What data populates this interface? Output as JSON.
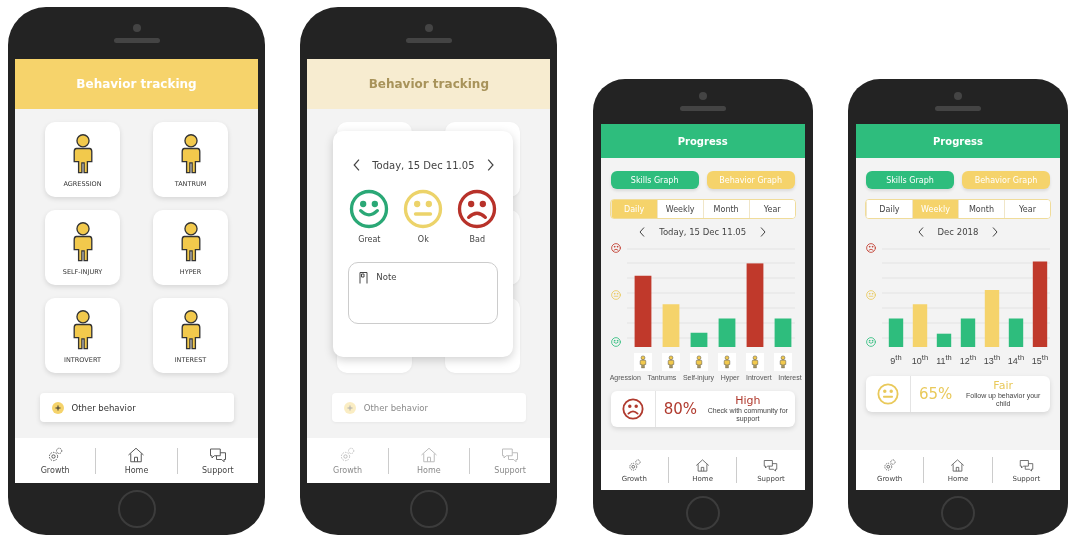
{
  "phones": [
    {
      "kind": "tracking",
      "title": "Behavior tracking",
      "behaviors": [
        {
          "label": "AGRESSION"
        },
        {
          "label": "TANTRUM"
        },
        {
          "label": "SELF-INJURY"
        },
        {
          "label": "HYPER"
        },
        {
          "label": "INTROVERT"
        },
        {
          "label": "INTEREST"
        }
      ],
      "other_behavior": "Other behavior",
      "nav": [
        {
          "kind": "growth",
          "label": "Growth"
        },
        {
          "kind": "home",
          "label": "Home"
        },
        {
          "kind": "support",
          "label": "Support"
        }
      ]
    },
    {
      "kind": "mood_dialog",
      "title": "Behavior tracking",
      "other_behavior": "Other behavior",
      "date": "Today, 15 Dec 11.05",
      "moods": [
        {
          "kind": "happy",
          "label": "Great",
          "color": "#2aa876"
        },
        {
          "kind": "neutral",
          "label": "Ok",
          "color": "#ecd36a"
        },
        {
          "kind": "sad",
          "label": "Bad",
          "color": "#b8322a"
        }
      ],
      "note": "Note",
      "nav": [
        {
          "kind": "growth",
          "label": "Growth"
        },
        {
          "kind": "home",
          "label": "Home"
        },
        {
          "kind": "support",
          "label": "Support"
        }
      ]
    },
    {
      "kind": "progress",
      "title": "Progress",
      "graph_buttons": [
        {
          "label": "Skills Graph",
          "color": "#2ebd7d"
        },
        {
          "label": "Behavior Graph",
          "color": "#f5d36b"
        }
      ],
      "periods": [
        {
          "label": "Daily",
          "selected": true
        },
        {
          "label": "Weekly",
          "selected": false
        },
        {
          "label": "Month",
          "selected": false
        },
        {
          "label": "Year",
          "selected": false
        }
      ],
      "date": "Today, 15 Dec 11.05",
      "label_tiles": true,
      "bars": [
        {
          "label": "Agression",
          "color": "#c0392b"
        },
        {
          "label": "Tantrums",
          "color": "#f5d36b"
        },
        {
          "label": "Self-injury",
          "color": "#2ebd7d"
        },
        {
          "label": "Hyper",
          "color": "#2ebd7d"
        },
        {
          "label": "Introvert",
          "color": "#c0392b"
        },
        {
          "label": "Interest",
          "color": "#2ebd7d"
        }
      ],
      "summary": {
        "kind": "sad",
        "percent": "80%",
        "rating": "High",
        "advice": "Check with community for support",
        "color": "#b03a2e"
      },
      "nav": [
        {
          "kind": "growth",
          "label": "Growth"
        },
        {
          "kind": "home",
          "label": "Home"
        },
        {
          "kind": "support",
          "label": "Support"
        }
      ]
    },
    {
      "kind": "progress",
      "title": "Progress",
      "graph_buttons": [
        {
          "label": "Skills Graph",
          "color": "#2ebd7d"
        },
        {
          "label": "Behavior Graph",
          "color": "#f5d36b"
        }
      ],
      "periods": [
        {
          "label": "Daily",
          "selected": false
        },
        {
          "label": "Weekly",
          "selected": true
        },
        {
          "label": "Month",
          "selected": false
        },
        {
          "label": "Year",
          "selected": false
        }
      ],
      "date": "Dec 2018",
      "bars": [
        {
          "label": "9$^{th}$",
          "color": "#2ebd7d"
        },
        {
          "label": "10$^{th}$",
          "color": "#f5d36b"
        },
        {
          "label": "11$^{th}$",
          "color": "#2ebd7d"
        },
        {
          "label": "12$^{th}$",
          "color": "#2ebd7d"
        },
        {
          "label": "13$^{th}$",
          "color": "#f5d36b"
        },
        {
          "label": "14$^{th}$",
          "color": "#2ebd7d"
        },
        {
          "label": "15$^{th}$",
          "color": "#c0392b"
        }
      ],
      "summary": {
        "kind": "neutral",
        "percent": "65%",
        "rating": "Fair",
        "advice": "Follow up behavior your child",
        "color": "#e9c95a"
      },
      "nav": [
        {
          "kind": "growth",
          "label": "Growth"
        },
        {
          "kind": "home",
          "label": "Home"
        },
        {
          "kind": "support",
          "label": "Support"
        }
      ]
    }
  ]
}
